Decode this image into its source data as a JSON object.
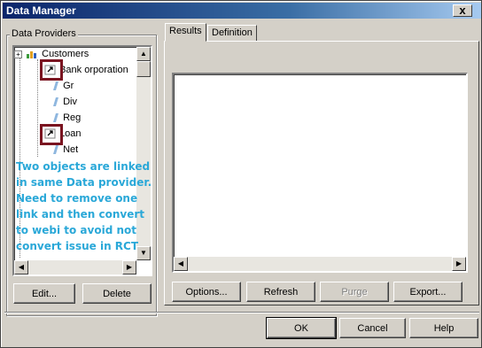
{
  "window": {
    "title": "Data Manager",
    "close_label": "x"
  },
  "providers": {
    "label": "Data Providers",
    "tree": [
      {
        "label": "Customers",
        "icon": "folder-chart-icon"
      },
      {
        "label": "Bank orporation",
        "icon": "link-icon"
      },
      {
        "label": "Gr",
        "icon": "dimension-icon"
      },
      {
        "label": "Div",
        "icon": "dimension-icon"
      },
      {
        "label": "Reg",
        "icon": "dimension-icon"
      },
      {
        "label": "Loan",
        "icon": "link-icon"
      },
      {
        "label": "Net",
        "icon": "dimension-icon"
      }
    ],
    "edit_label": "Edit...",
    "delete_label": "Delete"
  },
  "annotation": {
    "lines": [
      "Two objects are linked",
      "in same Data provider.",
      "Need to remove one",
      "link and then convert",
      "to webi to avoid not",
      "convert issue in RCT"
    ],
    "color": "#2aa8d8",
    "highlight_color": "#7a1420"
  },
  "tabs": [
    {
      "label": "Results"
    },
    {
      "label": "Definition"
    }
  ],
  "results": {
    "options_label": "Options...",
    "refresh_label": "Refresh",
    "purge_label": "Purge",
    "export_label": "Export..."
  },
  "footer": {
    "ok_label": "OK",
    "cancel_label": "Cancel",
    "help_label": "Help"
  }
}
